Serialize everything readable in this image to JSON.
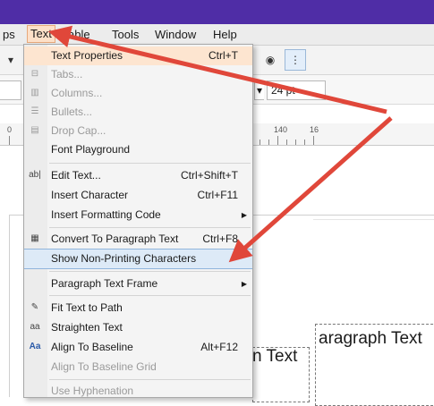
{
  "menubar": {
    "items": [
      {
        "label": "ps"
      },
      {
        "label": "Text"
      },
      {
        "label": "able"
      },
      {
        "label": "Tools"
      },
      {
        "label": "Window"
      },
      {
        "label": "Help"
      }
    ]
  },
  "propbar": {
    "font_size": "24 pt"
  },
  "ruler": {
    "labels": [
      "0",
      "140",
      "16"
    ]
  },
  "text_menu": {
    "items": [
      {
        "label": "Text Properties",
        "shortcut": "Ctrl+T",
        "enabled": true,
        "highlighted": true
      },
      {
        "label": "Tabs...",
        "enabled": false
      },
      {
        "label": "Columns...",
        "enabled": false
      },
      {
        "label": "Bullets...",
        "enabled": false
      },
      {
        "label": "Drop Cap...",
        "enabled": false
      },
      {
        "label": "Font Playground",
        "enabled": true
      },
      {
        "label": "Edit Text...",
        "shortcut": "Ctrl+Shift+T",
        "enabled": true
      },
      {
        "label": "Insert Character",
        "shortcut": "Ctrl+F11",
        "enabled": true
      },
      {
        "label": "Insert Formatting Code",
        "submenu": true,
        "enabled": true
      },
      {
        "label": "Convert To Paragraph Text",
        "shortcut": "Ctrl+F8",
        "enabled": true
      },
      {
        "label": "Show Non-Printing Characters",
        "enabled": true,
        "highlighted": true
      },
      {
        "label": "Paragraph Text Frame",
        "submenu": true,
        "enabled": true
      },
      {
        "label": "Fit Text to Path",
        "enabled": true
      },
      {
        "label": "Straighten Text",
        "enabled": true
      },
      {
        "label": "Align To Baseline",
        "shortcut": "Alt+F12",
        "enabled": true
      },
      {
        "label": "Align To Baseline Grid",
        "enabled": false
      },
      {
        "label": "Use Hyphenation",
        "enabled": false
      }
    ]
  },
  "canvas": {
    "frame_text_1": "aragraph Text",
    "frame_text_2": "n Text"
  },
  "colors": {
    "titlebar": "#4f2da6",
    "highlight": "#fde5d0",
    "annotation_arrow": "#e0473a"
  }
}
